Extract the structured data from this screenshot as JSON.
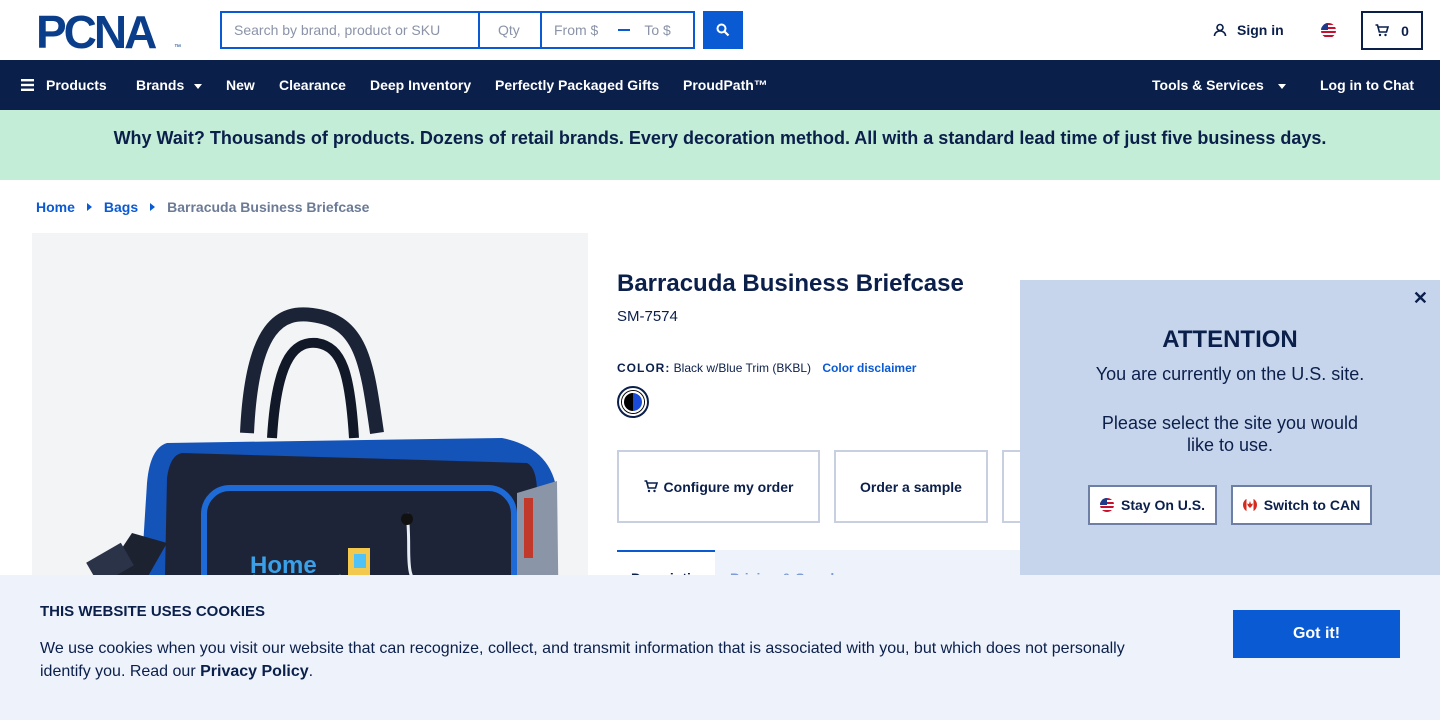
{
  "header": {
    "logo_text": "PCNA",
    "search_placeholder": "Search by brand, product or SKU",
    "qty_placeholder": "Qty",
    "price_from_placeholder": "From $",
    "price_to_placeholder": "To $",
    "signin_label": "Sign in",
    "cart_count": "0"
  },
  "nav": {
    "products": "Products",
    "brands": "Brands",
    "new": "New",
    "clearance": "Clearance",
    "deep_inventory": "Deep Inventory",
    "gifts": "Perfectly Packaged Gifts",
    "proudpath": "ProudPath™",
    "tools": "Tools & Services",
    "chat": "Log in to Chat"
  },
  "promo": {
    "text": "Why Wait? Thousands of products. Dozens of retail brands. Every decoration method. All with a standard lead time of just five business days."
  },
  "breadcrumb": {
    "home": "Home",
    "bags": "Bags",
    "current": "Barracuda Business Briefcase"
  },
  "product": {
    "title": "Barracuda Business Briefcase",
    "sku": "SM-7574",
    "color_label": "COLOR:",
    "color_value": "Black w/Blue Trim (BKBL)",
    "color_disclaimer": "Color disclaimer",
    "swatch_colors": [
      "#000000",
      "#1a4bd6"
    ],
    "actions": {
      "configure": "Configure my order",
      "sample": "Order a sample"
    },
    "tabs": {
      "active": "Description",
      "second": "Pricing & Supply"
    },
    "image_logo_text": "Home"
  },
  "attention": {
    "title": "ATTENTION",
    "message1": "You are currently on the U.S. site.",
    "message2": "Please select the site you would like to use.",
    "stay_label": "Stay On U.S.",
    "switch_label": "Switch to CAN"
  },
  "cookie": {
    "title": "THIS WEBSITE USES COOKIES",
    "text": "We use cookies when you visit our website that can recognize, collect, and transmit information that is associated with you, but which does not personally identify you. Read our",
    "link": "Privacy Policy",
    "end": ".",
    "button": "Got it!"
  },
  "colors": {
    "navy": "#0b1f4b",
    "blue": "#0a5ad4",
    "promo_bg": "#c3edd6",
    "panel_bg": "#c6d5ec",
    "cookie_bg": "#edf2fb"
  }
}
